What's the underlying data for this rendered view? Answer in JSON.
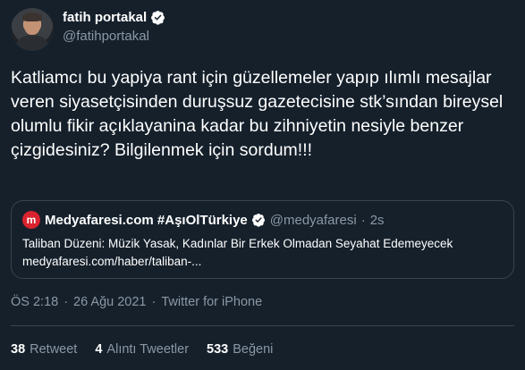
{
  "author": {
    "display_name": "fatih portakal",
    "handle": "@fatihportakal",
    "verified": true
  },
  "tweet": {
    "text": "Katliamcı bu yapiya rant için güzellemeler yapıp ılımlı mesajlar veren siyasetçisinden duruşsuz gazetecisine stk’sından bireysel olumlu fikir açıklayanina kadar bu zihniyetin nesiyle benzer çizgidesiniz? Bilgilenmek için sordum!!!"
  },
  "quoted_tweet": {
    "avatar_letter": "m",
    "display_name": "Medyafaresi.com #AşıOlTürkiye",
    "handle": "@medyafaresi",
    "separator": "·",
    "time": "2s",
    "line1": "Taliban Düzeni: Müzik Yasak, Kadınlar Bir Erkek Olmadan Seyahat Edemeyecek",
    "line2": "medyafaresi.com/haber/taliban-..."
  },
  "meta": {
    "time": "ÖS 2:18",
    "separator1": "·",
    "date": "26 Ağu 2021",
    "separator2": "·",
    "source": "Twitter for iPhone"
  },
  "stats": {
    "retweets_count": "38",
    "retweets_label": "Retweet",
    "quotes_count": "4",
    "quotes_label": "Alıntı Tweetler",
    "likes_count": "533",
    "likes_label": "Beğeni"
  },
  "colors": {
    "background": "#15202b",
    "secondary_text": "#8b98a5",
    "border": "#38444d",
    "verified_badge": "#ffffff"
  }
}
